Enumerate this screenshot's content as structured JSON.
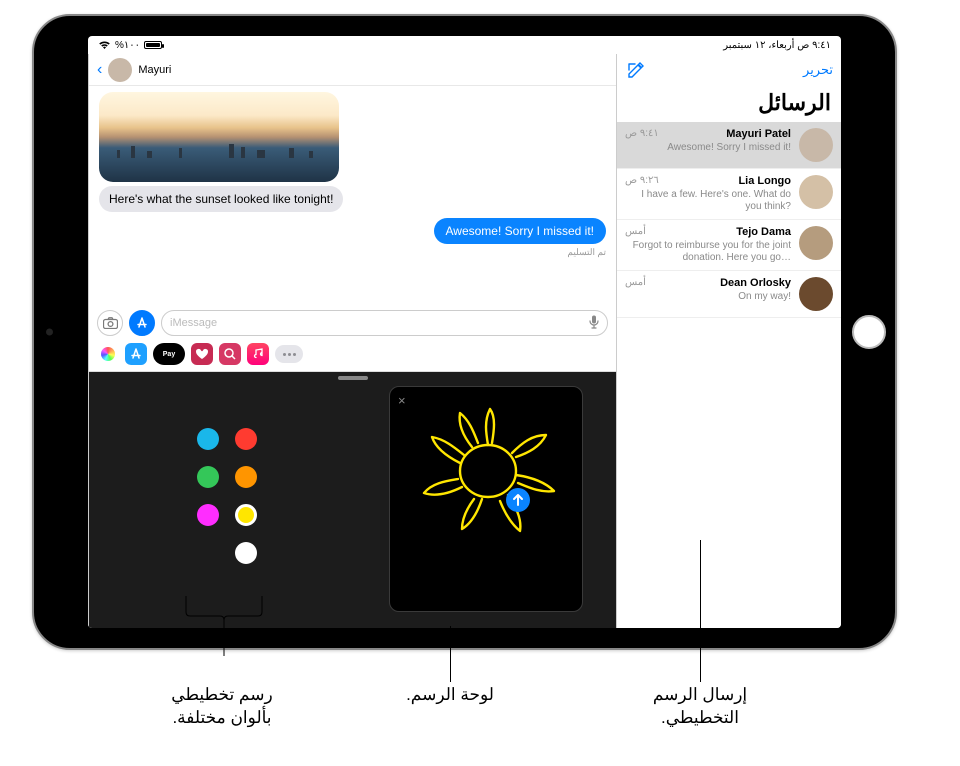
{
  "status": {
    "time": "٩:٤١ ص  أربعاء، ١٢ سبتمبر",
    "battery": "%١٠٠",
    "wifi": "wifi"
  },
  "sidebar": {
    "edit": "تحرير",
    "title": "الرسائل",
    "items": [
      {
        "name": "Mayuri Patel",
        "time": "٩:٤١ ص",
        "preview": "Awesome! Sorry I missed it!"
      },
      {
        "name": "Lia Longo",
        "time": "٩:٢٦ ص",
        "preview": "I have a few. Here's one. What do you think?"
      },
      {
        "name": "Tejo Dama",
        "time": "أمس",
        "preview": "Forgot to reimburse you for the joint donation. Here you go…"
      },
      {
        "name": "Dean Orlosky",
        "time": "أمس",
        "preview": "On my way!"
      }
    ]
  },
  "conversation": {
    "contact": "Mayuri",
    "incoming": "Here's what the sunset looked like tonight!",
    "outgoing": "Awesome! Sorry I missed it!",
    "deliveredLabel": "تم التسليم",
    "inputPlaceholder": "iMessage",
    "applePay": "Pay"
  },
  "callouts": {
    "colors": "رسم تخطيطي\nبألوان مختلفة.",
    "canvas": "لوحة الرسم.",
    "send": "إرسال الرسم\nالتخطيطي."
  }
}
